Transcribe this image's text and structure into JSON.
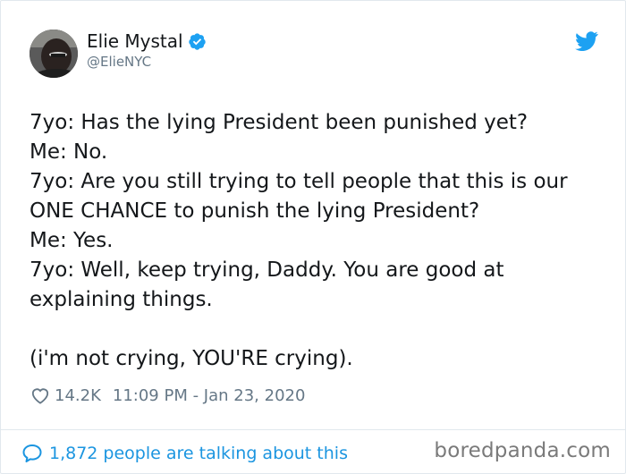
{
  "colors": {
    "twitter_blue": "#1DA1F2",
    "link_blue": "#1b95e0",
    "secondary_text": "#657786",
    "primary_text": "#14171a"
  },
  "tweet": {
    "author": {
      "display_name": "Elie Mystal",
      "handle": "@ElieNYC",
      "verified": true,
      "verified_icon": "verified-badge-icon",
      "avatar_icon": "avatar"
    },
    "platform_icon": "twitter-bird-icon",
    "text": "7yo: Has the lying President been punished yet?\nMe: No.\n7yo: Are you still trying to tell people that this is our ONE CHANCE to punish the lying President?\nMe: Yes.\n7yo: Well, keep trying, Daddy. You are good at explaining things.\n\n(i'm not crying, YOU'RE crying).",
    "likes": "14.2K",
    "like_icon": "heart-icon",
    "timestamp": "11:09 PM - Jan 23, 2020"
  },
  "footer": {
    "conversation_icon": "speech-bubble-icon",
    "conversation_label": "1,872 people are talking about this"
  },
  "watermark": "boredpanda.com"
}
